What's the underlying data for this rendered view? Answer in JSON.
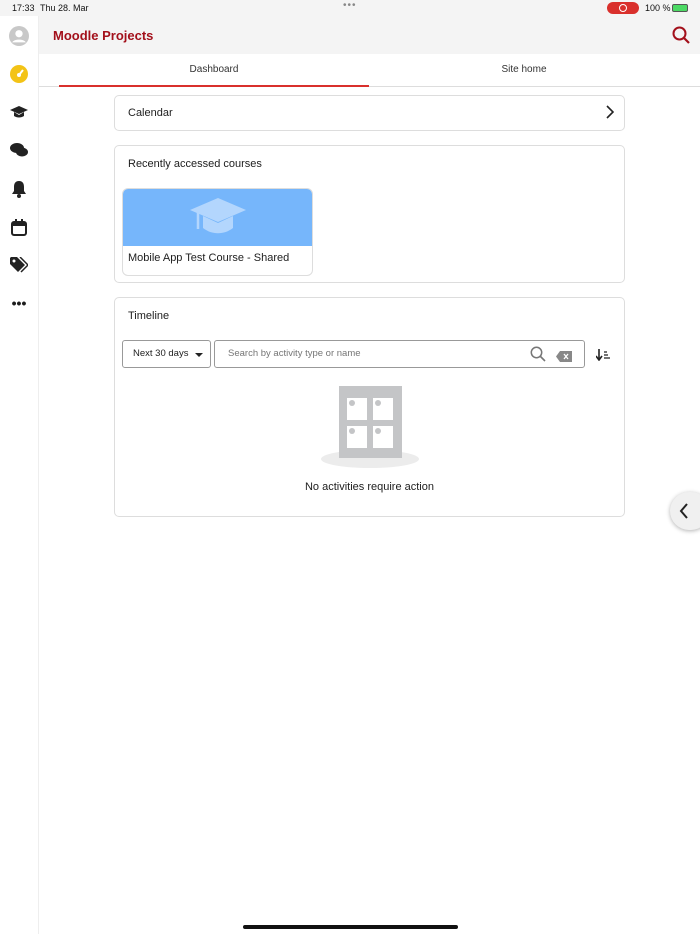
{
  "status_bar": {
    "time": "17:33",
    "date": "Thu 28. Mar",
    "battery": "100 %"
  },
  "header": {
    "title": "Moodle Projects"
  },
  "tabs": [
    {
      "label": "Dashboard"
    },
    {
      "label": "Site home"
    }
  ],
  "calendar": {
    "label": "Calendar"
  },
  "recent": {
    "title": "Recently accessed courses",
    "courses": [
      {
        "name": "Mobile App Test Course - Shared"
      }
    ]
  },
  "timeline": {
    "title": "Timeline",
    "filter": "Next 30 days",
    "search_placeholder": "Search by activity type or name",
    "empty": "No activities require action"
  },
  "colors": {
    "brand": "#a3101b",
    "accent": "#d9302c",
    "course_bg": "#76b6fb"
  }
}
